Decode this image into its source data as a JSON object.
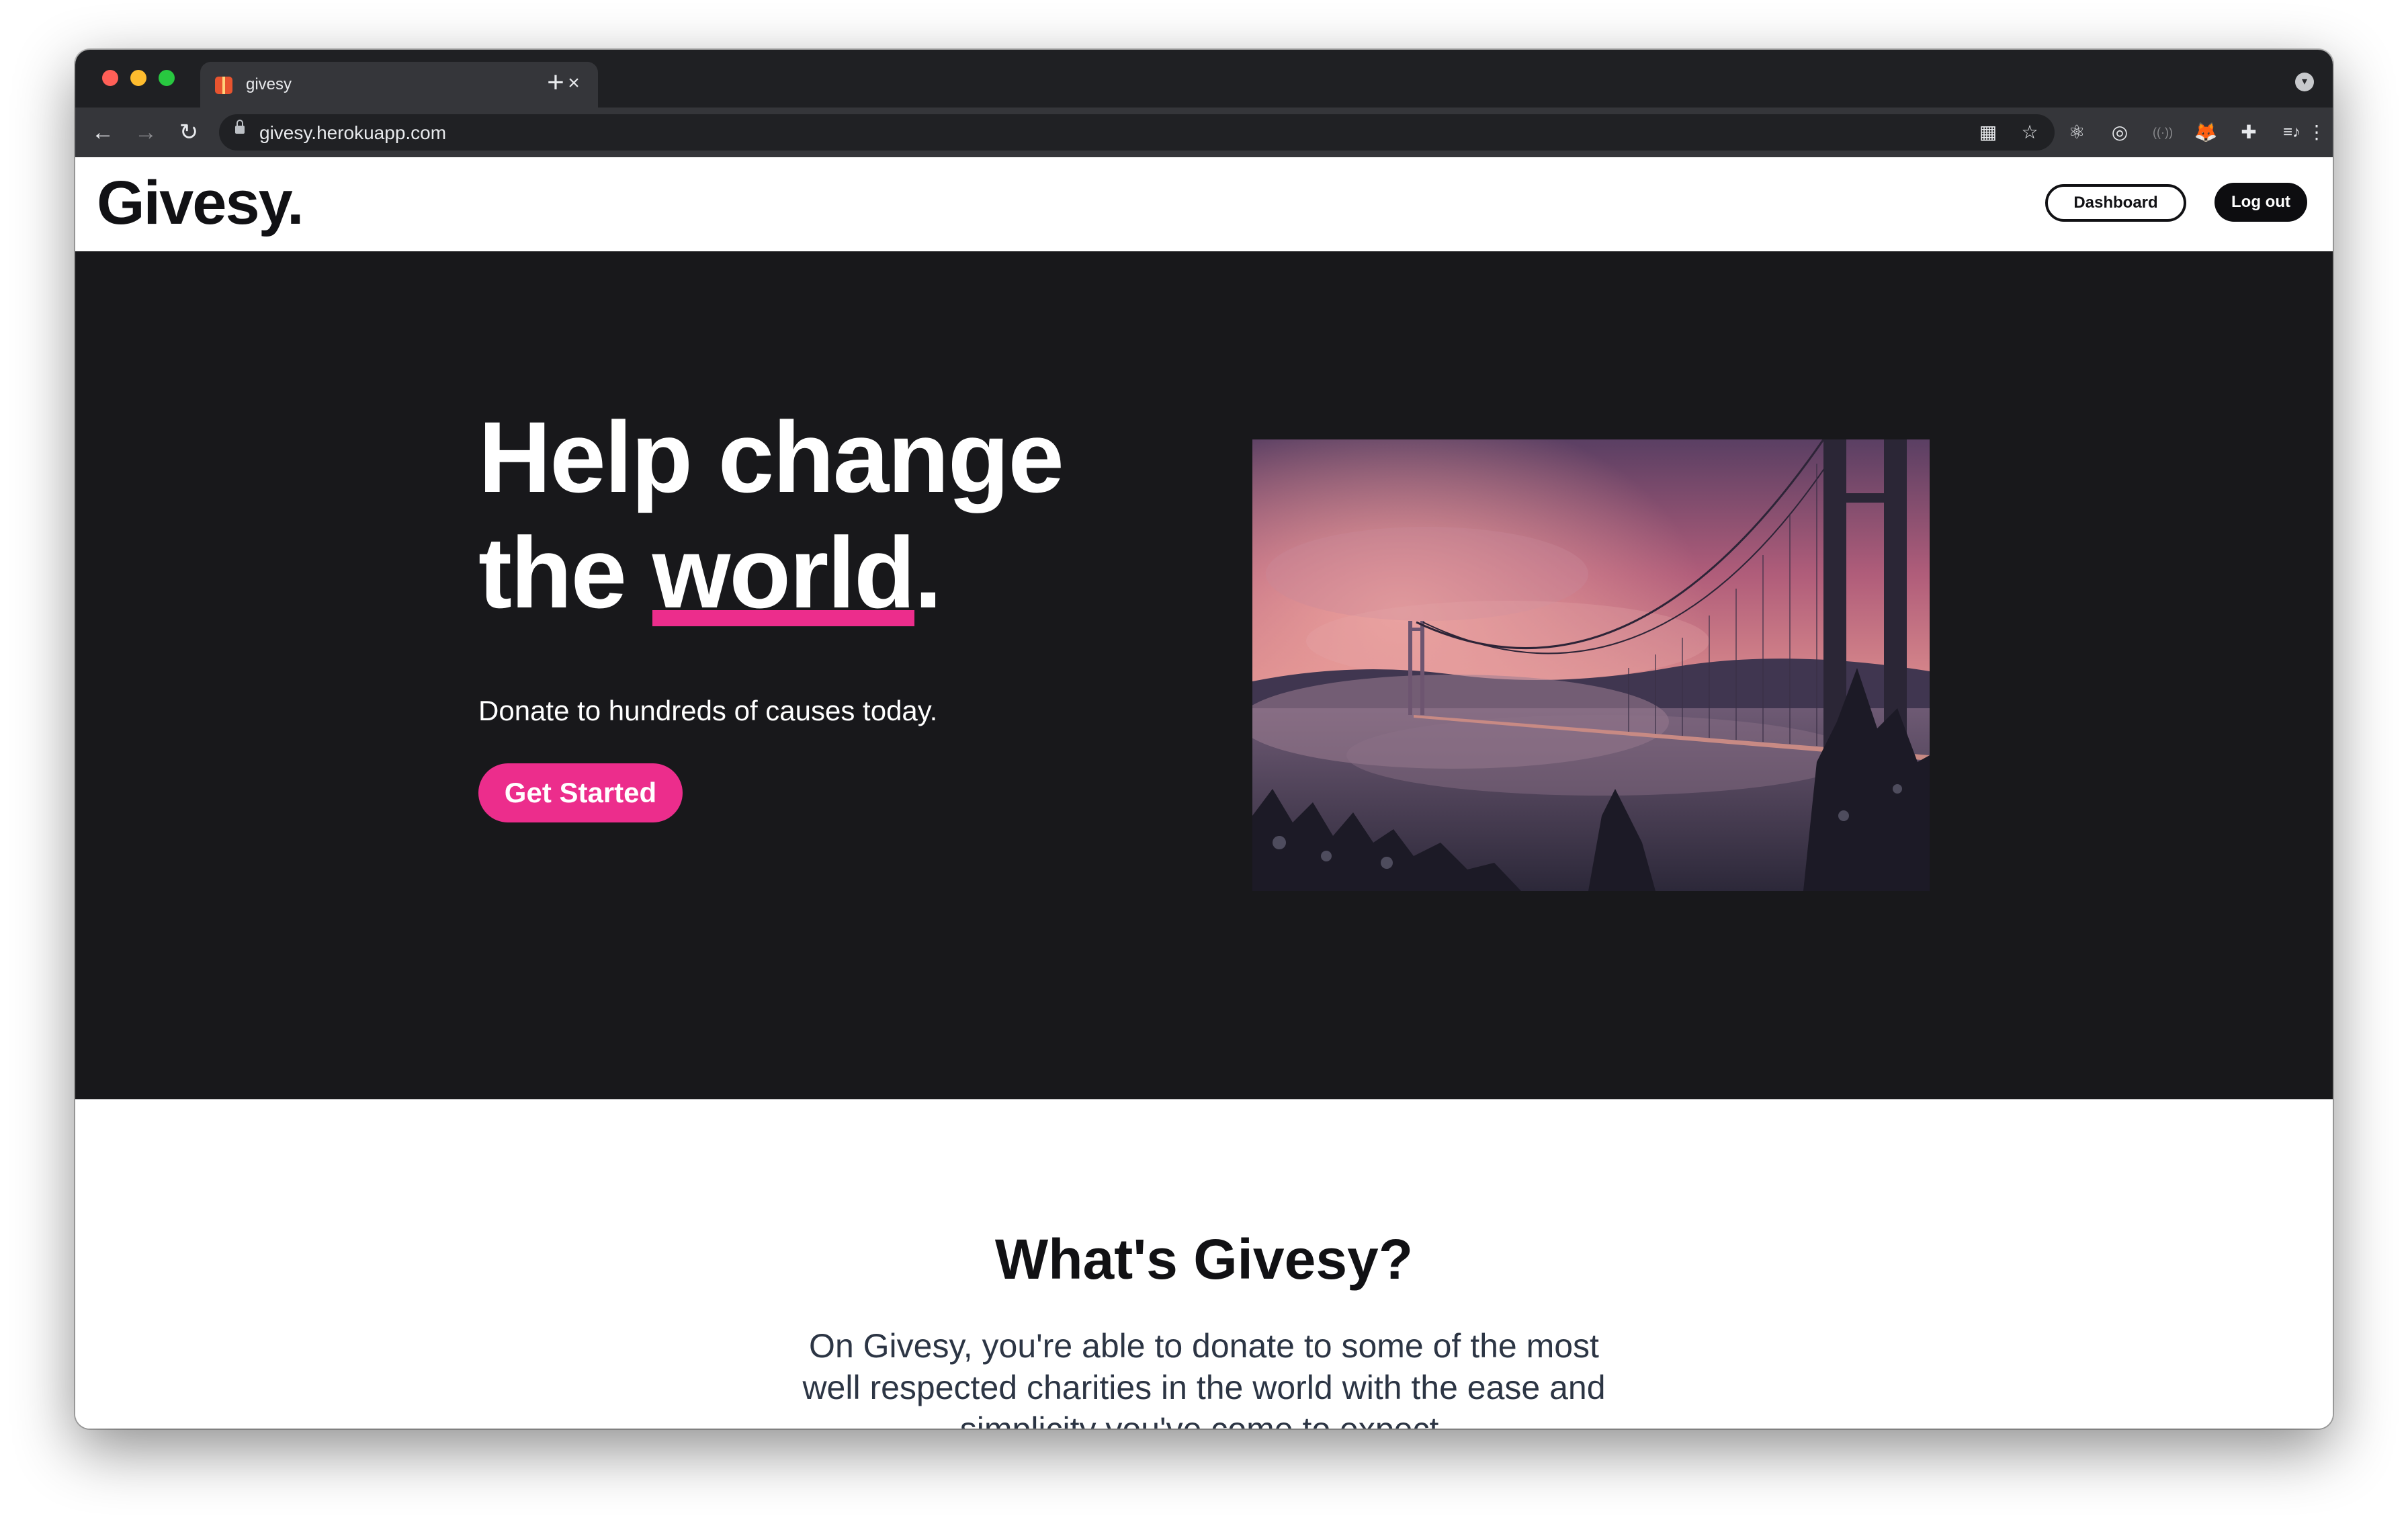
{
  "browser": {
    "tab_title": "givesy",
    "tab_close": "×",
    "new_tab": "+",
    "url": "givesy.herokuapp.com",
    "icons": {
      "back": "←",
      "forward": "→",
      "reload": "↻",
      "qr": "▦",
      "star": "☆",
      "react_devtools": "⚛",
      "target": "◎",
      "broadcast": "((·))",
      "metamask": "🦊",
      "puzzle": "✚",
      "playlist": "≡♪",
      "menu": "⋮",
      "profile": "▾"
    }
  },
  "site": {
    "logo": "Givesy.",
    "dashboard_label": "Dashboard",
    "logout_label": "Log out",
    "hero": {
      "title_line1": "Help change",
      "title_line2_prefix": "the ",
      "title_line2_underlined": "world",
      "title_line2_suffix": ".",
      "subtitle": "Donate to hundreds of causes today.",
      "cta_label": "Get Started",
      "image_alt": "suspension bridge over misty water at sunset"
    },
    "about": {
      "title": "What's Givesy?",
      "text": "On Givesy, you're able to donate to some of the most well respected charities in the world with the ease and simplicity you've come to expect."
    },
    "colors": {
      "accent": "#ec2d8c",
      "hero_bg": "#18181b",
      "text_dark": "#111114"
    }
  }
}
